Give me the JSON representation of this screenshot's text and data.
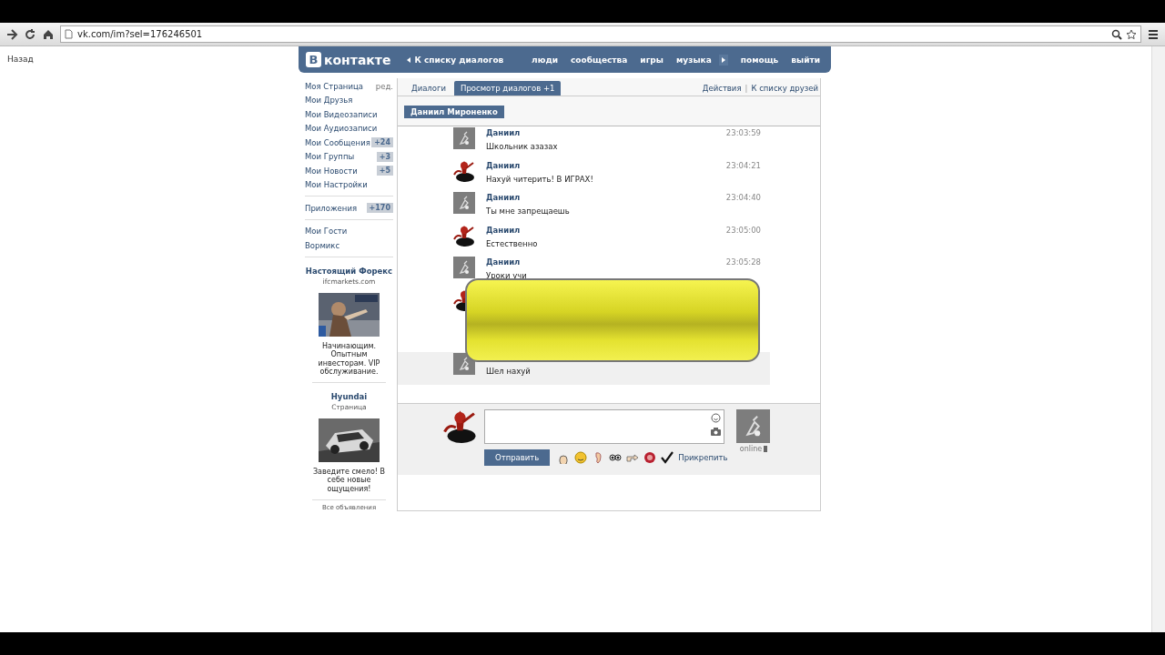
{
  "browser": {
    "url": "vk.com/im?sel=176246501"
  },
  "back_link": "Назад",
  "header": {
    "logo_letter": "В",
    "logo_text": "контакте",
    "back_to_dialogs": "К списку диалогов",
    "nav": [
      {
        "label": "люди",
        "player": false
      },
      {
        "label": "сообщества",
        "player": false
      },
      {
        "label": "игры",
        "player": false
      },
      {
        "label": "музыка",
        "player": true
      },
      {
        "label": "помощь",
        "player": false
      },
      {
        "label": "выйти",
        "player": false
      }
    ]
  },
  "sidebar": {
    "edit": "ред.",
    "groups": [
      [
        {
          "label": "Моя Страница"
        },
        {
          "label": "Мои Друзья"
        },
        {
          "label": "Мои Видеозаписи"
        },
        {
          "label": "Мои Аудиозаписи"
        },
        {
          "label": "Мои Сообщения",
          "badge": "+24"
        },
        {
          "label": "Мои Группы",
          "badge": "+3"
        },
        {
          "label": "Мои Новости",
          "badge": "+5"
        },
        {
          "label": "Мои Настройки"
        }
      ],
      [
        {
          "label": "Приложения",
          "badge": "+170"
        }
      ],
      [
        {
          "label": "Мои Гости"
        },
        {
          "label": "Вормикс"
        }
      ]
    ]
  },
  "ads": [
    {
      "title": "Настоящий Форекс",
      "subtitle": "ifcmarkets.com",
      "text": "Начинающим. Опытным инвесторам. VIP обслуживание."
    },
    {
      "title": "Hyundai",
      "subtitle": "Страница",
      "text": "Заведите смело! В себе новые ощущения!"
    }
  ],
  "all_ads": "Все объявления",
  "tabs": [
    {
      "label": "Диалоги",
      "selected": false
    },
    {
      "label": "Просмотр диалогов +1",
      "selected": true
    }
  ],
  "actions": [
    "Действия",
    "К списку друзей"
  ],
  "actions_separator": "|",
  "conversation_name": "Даниил Мироненко",
  "messages": [
    {
      "outgoing": false,
      "name": "Даниил",
      "time": "23:03:59",
      "text": "Школьник азазах",
      "highlighted": false
    },
    {
      "outgoing": true,
      "name": "Даниил",
      "time": "23:04:21",
      "text": "Нахуй читерить! В ИГРАХ!",
      "highlighted": false
    },
    {
      "outgoing": false,
      "name": "Даниил",
      "time": "23:04:40",
      "text": "Ты мне запрещаешь",
      "highlighted": false
    },
    {
      "outgoing": true,
      "name": "Даниил",
      "time": "23:05:00",
      "text": "Естественно",
      "highlighted": false
    },
    {
      "outgoing": false,
      "name": "Даниил",
      "time": "23:05:28",
      "text": "Уроки учи",
      "highlighted": false
    },
    {
      "outgoing": true,
      "highlighted": false
    },
    {
      "outgoing": false,
      "text": "Шел нахуй",
      "highlighted": true
    }
  ],
  "compose": {
    "send": "Отправить",
    "attach": "Прикрепить",
    "status": "online"
  }
}
